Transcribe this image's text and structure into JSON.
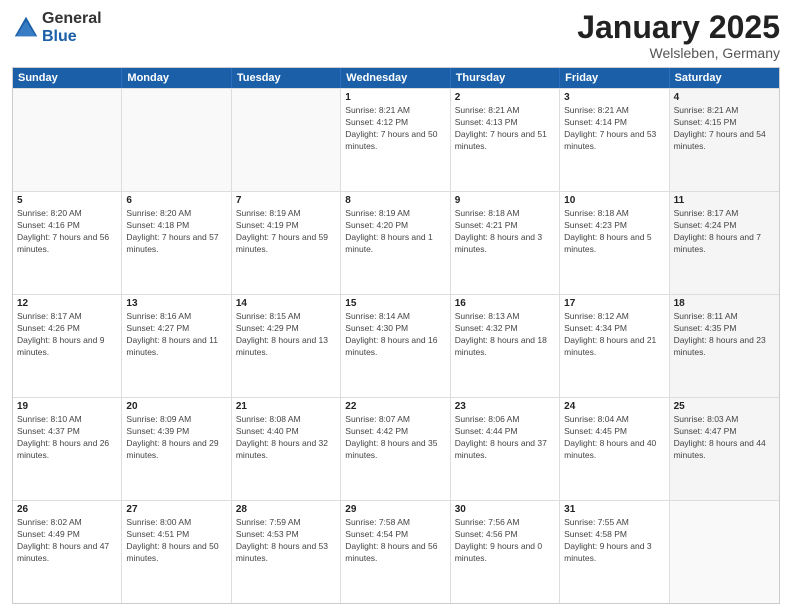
{
  "logo": {
    "general": "General",
    "blue": "Blue"
  },
  "title": "January 2025",
  "location": "Welsleben, Germany",
  "weekdays": [
    "Sunday",
    "Monday",
    "Tuesday",
    "Wednesday",
    "Thursday",
    "Friday",
    "Saturday"
  ],
  "rows": [
    [
      {
        "day": "",
        "sunrise": "",
        "sunset": "",
        "daylight": "",
        "empty": true
      },
      {
        "day": "",
        "sunrise": "",
        "sunset": "",
        "daylight": "",
        "empty": true
      },
      {
        "day": "",
        "sunrise": "",
        "sunset": "",
        "daylight": "",
        "empty": true
      },
      {
        "day": "1",
        "sunrise": "Sunrise: 8:21 AM",
        "sunset": "Sunset: 4:12 PM",
        "daylight": "Daylight: 7 hours and 50 minutes.",
        "empty": false
      },
      {
        "day": "2",
        "sunrise": "Sunrise: 8:21 AM",
        "sunset": "Sunset: 4:13 PM",
        "daylight": "Daylight: 7 hours and 51 minutes.",
        "empty": false
      },
      {
        "day": "3",
        "sunrise": "Sunrise: 8:21 AM",
        "sunset": "Sunset: 4:14 PM",
        "daylight": "Daylight: 7 hours and 53 minutes.",
        "empty": false
      },
      {
        "day": "4",
        "sunrise": "Sunrise: 8:21 AM",
        "sunset": "Sunset: 4:15 PM",
        "daylight": "Daylight: 7 hours and 54 minutes.",
        "empty": false,
        "shaded": true
      }
    ],
    [
      {
        "day": "5",
        "sunrise": "Sunrise: 8:20 AM",
        "sunset": "Sunset: 4:16 PM",
        "daylight": "Daylight: 7 hours and 56 minutes.",
        "empty": false
      },
      {
        "day": "6",
        "sunrise": "Sunrise: 8:20 AM",
        "sunset": "Sunset: 4:18 PM",
        "daylight": "Daylight: 7 hours and 57 minutes.",
        "empty": false
      },
      {
        "day": "7",
        "sunrise": "Sunrise: 8:19 AM",
        "sunset": "Sunset: 4:19 PM",
        "daylight": "Daylight: 7 hours and 59 minutes.",
        "empty": false
      },
      {
        "day": "8",
        "sunrise": "Sunrise: 8:19 AM",
        "sunset": "Sunset: 4:20 PM",
        "daylight": "Daylight: 8 hours and 1 minute.",
        "empty": false
      },
      {
        "day": "9",
        "sunrise": "Sunrise: 8:18 AM",
        "sunset": "Sunset: 4:21 PM",
        "daylight": "Daylight: 8 hours and 3 minutes.",
        "empty": false
      },
      {
        "day": "10",
        "sunrise": "Sunrise: 8:18 AM",
        "sunset": "Sunset: 4:23 PM",
        "daylight": "Daylight: 8 hours and 5 minutes.",
        "empty": false
      },
      {
        "day": "11",
        "sunrise": "Sunrise: 8:17 AM",
        "sunset": "Sunset: 4:24 PM",
        "daylight": "Daylight: 8 hours and 7 minutes.",
        "empty": false,
        "shaded": true
      }
    ],
    [
      {
        "day": "12",
        "sunrise": "Sunrise: 8:17 AM",
        "sunset": "Sunset: 4:26 PM",
        "daylight": "Daylight: 8 hours and 9 minutes.",
        "empty": false
      },
      {
        "day": "13",
        "sunrise": "Sunrise: 8:16 AM",
        "sunset": "Sunset: 4:27 PM",
        "daylight": "Daylight: 8 hours and 11 minutes.",
        "empty": false
      },
      {
        "day": "14",
        "sunrise": "Sunrise: 8:15 AM",
        "sunset": "Sunset: 4:29 PM",
        "daylight": "Daylight: 8 hours and 13 minutes.",
        "empty": false
      },
      {
        "day": "15",
        "sunrise": "Sunrise: 8:14 AM",
        "sunset": "Sunset: 4:30 PM",
        "daylight": "Daylight: 8 hours and 16 minutes.",
        "empty": false
      },
      {
        "day": "16",
        "sunrise": "Sunrise: 8:13 AM",
        "sunset": "Sunset: 4:32 PM",
        "daylight": "Daylight: 8 hours and 18 minutes.",
        "empty": false
      },
      {
        "day": "17",
        "sunrise": "Sunrise: 8:12 AM",
        "sunset": "Sunset: 4:34 PM",
        "daylight": "Daylight: 8 hours and 21 minutes.",
        "empty": false
      },
      {
        "day": "18",
        "sunrise": "Sunrise: 8:11 AM",
        "sunset": "Sunset: 4:35 PM",
        "daylight": "Daylight: 8 hours and 23 minutes.",
        "empty": false,
        "shaded": true
      }
    ],
    [
      {
        "day": "19",
        "sunrise": "Sunrise: 8:10 AM",
        "sunset": "Sunset: 4:37 PM",
        "daylight": "Daylight: 8 hours and 26 minutes.",
        "empty": false
      },
      {
        "day": "20",
        "sunrise": "Sunrise: 8:09 AM",
        "sunset": "Sunset: 4:39 PM",
        "daylight": "Daylight: 8 hours and 29 minutes.",
        "empty": false
      },
      {
        "day": "21",
        "sunrise": "Sunrise: 8:08 AM",
        "sunset": "Sunset: 4:40 PM",
        "daylight": "Daylight: 8 hours and 32 minutes.",
        "empty": false
      },
      {
        "day": "22",
        "sunrise": "Sunrise: 8:07 AM",
        "sunset": "Sunset: 4:42 PM",
        "daylight": "Daylight: 8 hours and 35 minutes.",
        "empty": false
      },
      {
        "day": "23",
        "sunrise": "Sunrise: 8:06 AM",
        "sunset": "Sunset: 4:44 PM",
        "daylight": "Daylight: 8 hours and 37 minutes.",
        "empty": false
      },
      {
        "day": "24",
        "sunrise": "Sunrise: 8:04 AM",
        "sunset": "Sunset: 4:45 PM",
        "daylight": "Daylight: 8 hours and 40 minutes.",
        "empty": false
      },
      {
        "day": "25",
        "sunrise": "Sunrise: 8:03 AM",
        "sunset": "Sunset: 4:47 PM",
        "daylight": "Daylight: 8 hours and 44 minutes.",
        "empty": false,
        "shaded": true
      }
    ],
    [
      {
        "day": "26",
        "sunrise": "Sunrise: 8:02 AM",
        "sunset": "Sunset: 4:49 PM",
        "daylight": "Daylight: 8 hours and 47 minutes.",
        "empty": false
      },
      {
        "day": "27",
        "sunrise": "Sunrise: 8:00 AM",
        "sunset": "Sunset: 4:51 PM",
        "daylight": "Daylight: 8 hours and 50 minutes.",
        "empty": false
      },
      {
        "day": "28",
        "sunrise": "Sunrise: 7:59 AM",
        "sunset": "Sunset: 4:53 PM",
        "daylight": "Daylight: 8 hours and 53 minutes.",
        "empty": false
      },
      {
        "day": "29",
        "sunrise": "Sunrise: 7:58 AM",
        "sunset": "Sunset: 4:54 PM",
        "daylight": "Daylight: 8 hours and 56 minutes.",
        "empty": false
      },
      {
        "day": "30",
        "sunrise": "Sunrise: 7:56 AM",
        "sunset": "Sunset: 4:56 PM",
        "daylight": "Daylight: 9 hours and 0 minutes.",
        "empty": false
      },
      {
        "day": "31",
        "sunrise": "Sunrise: 7:55 AM",
        "sunset": "Sunset: 4:58 PM",
        "daylight": "Daylight: 9 hours and 3 minutes.",
        "empty": false
      },
      {
        "day": "",
        "sunrise": "",
        "sunset": "",
        "daylight": "",
        "empty": true,
        "shaded": true
      }
    ]
  ]
}
